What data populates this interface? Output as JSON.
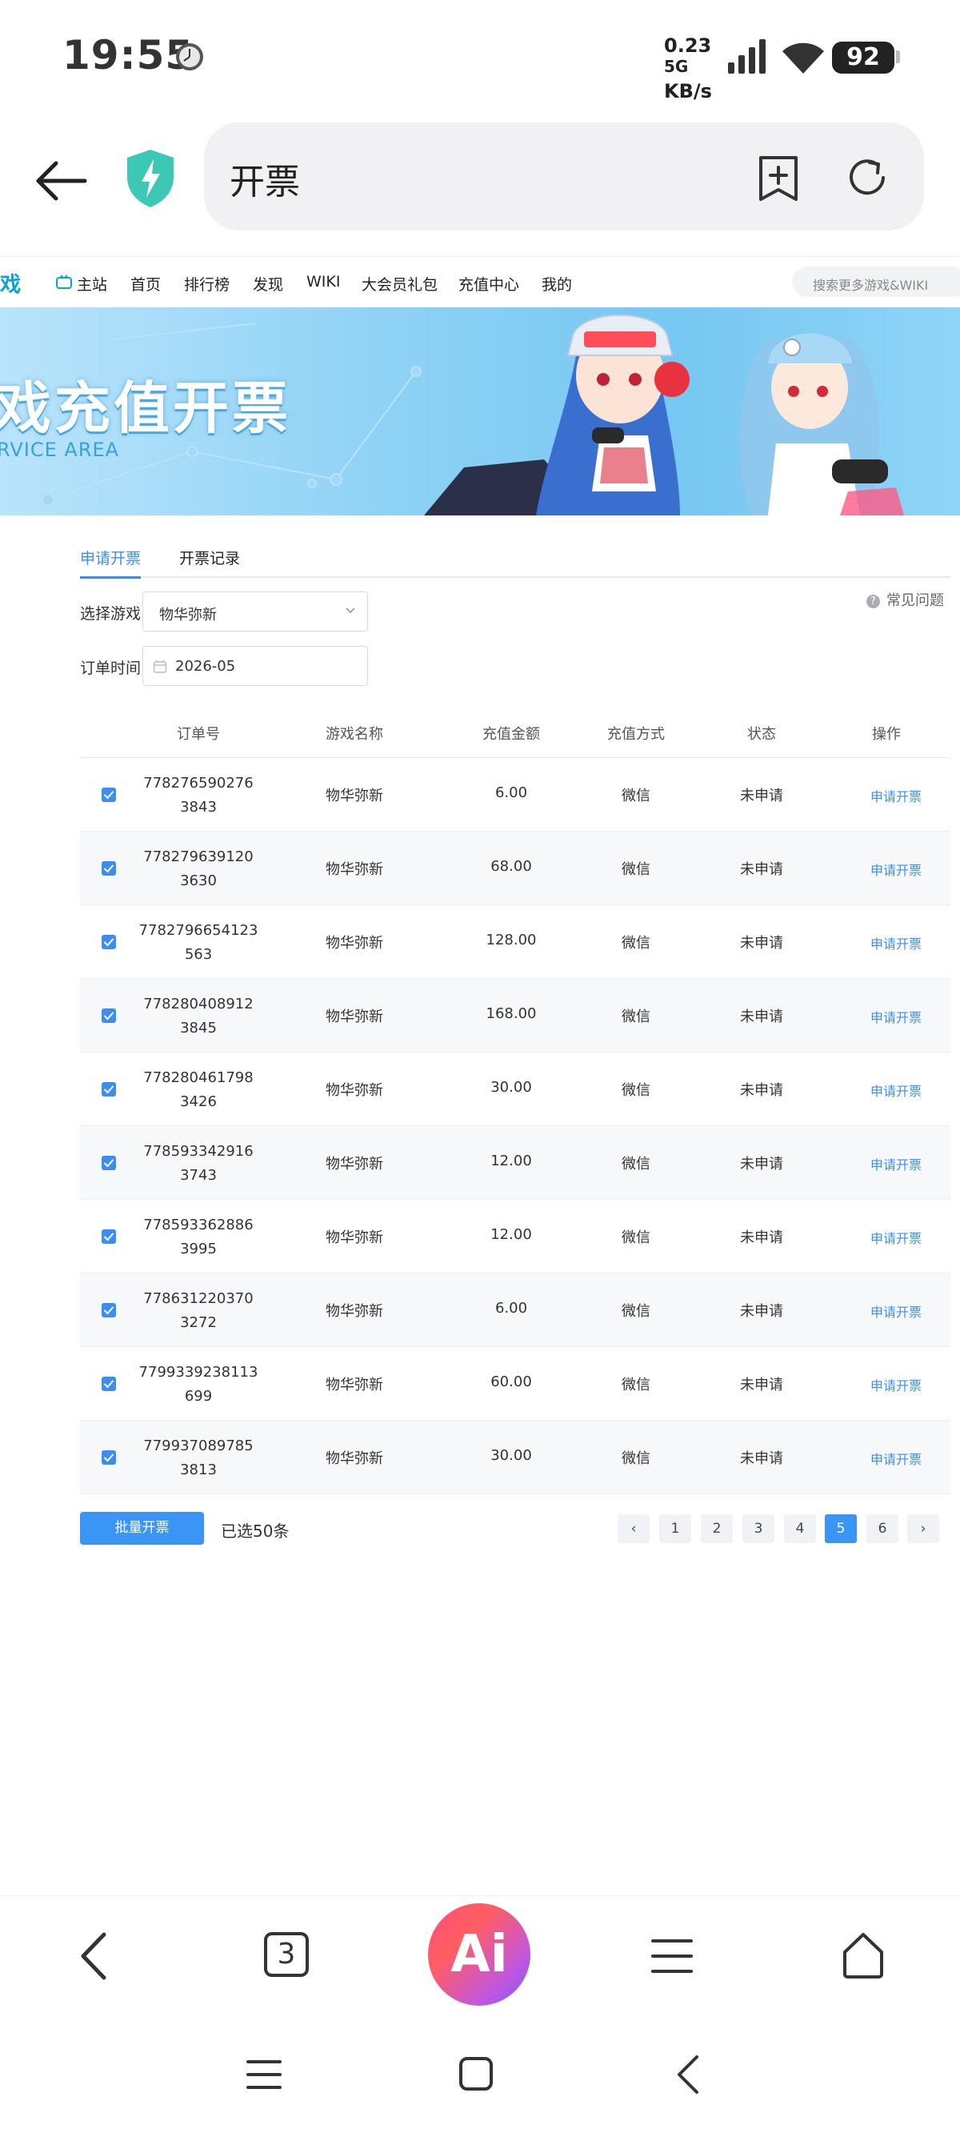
{
  "status_bar": {
    "time": "19:55",
    "net_speed_value": "0.23",
    "net_speed_unit": "KB/s",
    "network": "5G",
    "battery": "92"
  },
  "browser": {
    "url_text": "开票"
  },
  "site_nav": {
    "logo_fragment": "戏",
    "items": [
      "主站",
      "首页",
      "排行榜",
      "发现",
      "WIKI",
      "大会员礼包",
      "充值中心",
      "我的"
    ],
    "search_placeholder": "搜索更多游戏&WIKI"
  },
  "banner": {
    "title": "戏充值开票",
    "subtitle": "RVICE AREA"
  },
  "tabs": [
    "申请开票",
    "开票记录"
  ],
  "faq_label": "常见问题",
  "filters": {
    "game_label": "选择游戏",
    "game_value": "物华弥新",
    "time_label": "订单时间",
    "time_value": "2026-05"
  },
  "table": {
    "headers": [
      "订单号",
      "游戏名称",
      "充值金额",
      "充值方式",
      "状态",
      "操作"
    ],
    "rows": [
      {
        "order_1": "778276590276",
        "order_2": "3843",
        "game": "物华弥新",
        "amount": "6.00",
        "method": "微信",
        "status": "未申请",
        "action": "申请开票"
      },
      {
        "order_1": "778279639120",
        "order_2": "3630",
        "game": "物华弥新",
        "amount": "68.00",
        "method": "微信",
        "status": "未申请",
        "action": "申请开票"
      },
      {
        "order_1": "7782796654123",
        "order_2": "563",
        "game": "物华弥新",
        "amount": "128.00",
        "method": "微信",
        "status": "未申请",
        "action": "申请开票"
      },
      {
        "order_1": "778280408912",
        "order_2": "3845",
        "game": "物华弥新",
        "amount": "168.00",
        "method": "微信",
        "status": "未申请",
        "action": "申请开票"
      },
      {
        "order_1": "778280461798",
        "order_2": "3426",
        "game": "物华弥新",
        "amount": "30.00",
        "method": "微信",
        "status": "未申请",
        "action": "申请开票"
      },
      {
        "order_1": "778593342916",
        "order_2": "3743",
        "game": "物华弥新",
        "amount": "12.00",
        "method": "微信",
        "status": "未申请",
        "action": "申请开票"
      },
      {
        "order_1": "778593362886",
        "order_2": "3995",
        "game": "物华弥新",
        "amount": "12.00",
        "method": "微信",
        "status": "未申请",
        "action": "申请开票"
      },
      {
        "order_1": "778631220370",
        "order_2": "3272",
        "game": "物华弥新",
        "amount": "6.00",
        "method": "微信",
        "status": "未申请",
        "action": "申请开票"
      },
      {
        "order_1": "7799339238113",
        "order_2": "699",
        "game": "物华弥新",
        "amount": "60.00",
        "method": "微信",
        "status": "未申请",
        "action": "申请开票"
      },
      {
        "order_1": "779937089785",
        "order_2": "3813",
        "game": "物华弥新",
        "amount": "30.00",
        "method": "微信",
        "status": "未申请",
        "action": "申请开票"
      }
    ]
  },
  "footer": {
    "batch_button": "批量开票",
    "selected_text": "已选50条",
    "pages": [
      "1",
      "2",
      "3",
      "4",
      "5",
      "6"
    ],
    "current_page": "5",
    "prev": "‹",
    "next": "›"
  },
  "toolbar": {
    "tab_count": "3",
    "ai_label": "Ai"
  },
  "colors": {
    "accent": "#3b8ef0",
    "button": "#3b95f5"
  }
}
